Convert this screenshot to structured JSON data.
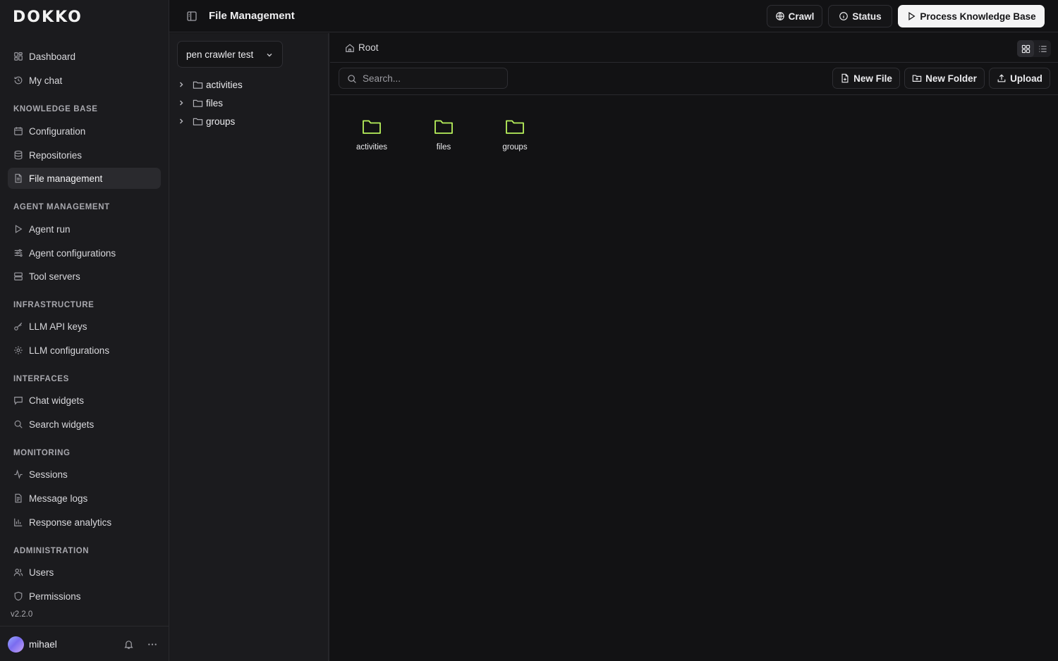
{
  "app": {
    "logo": "DOKKO",
    "version": "v2.2.0"
  },
  "sidebar": {
    "top_items": [
      {
        "label": "Dashboard",
        "icon": "dashboard-icon"
      },
      {
        "label": "My chat",
        "icon": "history-icon"
      }
    ],
    "sections": [
      {
        "title": "KNOWLEDGE BASE",
        "items": [
          {
            "label": "Configuration",
            "icon": "calendar-icon"
          },
          {
            "label": "Repositories",
            "icon": "database-icon"
          },
          {
            "label": "File management",
            "icon": "file-icon",
            "active": true
          }
        ]
      },
      {
        "title": "AGENT MANAGEMENT",
        "items": [
          {
            "label": "Agent run",
            "icon": "play-icon"
          },
          {
            "label": "Agent configurations",
            "icon": "sliders-icon"
          },
          {
            "label": "Tool servers",
            "icon": "server-icon"
          }
        ]
      },
      {
        "title": "INFRASTRUCTURE",
        "items": [
          {
            "label": "LLM API keys",
            "icon": "key-icon"
          },
          {
            "label": "LLM configurations",
            "icon": "gear-icon"
          }
        ]
      },
      {
        "title": "INTERFACES",
        "items": [
          {
            "label": "Chat widgets",
            "icon": "chat-icon"
          },
          {
            "label": "Search widgets",
            "icon": "search-icon"
          }
        ]
      },
      {
        "title": "MONITORING",
        "items": [
          {
            "label": "Sessions",
            "icon": "activity-icon"
          },
          {
            "label": "Message logs",
            "icon": "log-icon"
          },
          {
            "label": "Response analytics",
            "icon": "bar-chart-icon"
          }
        ]
      },
      {
        "title": "ADMINISTRATION",
        "items": [
          {
            "label": "Users",
            "icon": "users-icon"
          },
          {
            "label": "Permissions",
            "icon": "shield-icon"
          }
        ]
      }
    ],
    "user": {
      "name": "mihael"
    }
  },
  "header": {
    "title": "File Management",
    "crawl_label": "Crawl",
    "status_label": "Status",
    "process_label": "Process Knowledge Base"
  },
  "tree": {
    "repository": "pen crawler test",
    "folders": [
      "activities",
      "files",
      "groups"
    ]
  },
  "content": {
    "breadcrumb": "Root",
    "search_placeholder": "Search...",
    "new_file_label": "New File",
    "new_folder_label": "New Folder",
    "upload_label": "Upload",
    "view_mode": "grid",
    "folders": [
      "activities",
      "files",
      "groups"
    ]
  },
  "colors": {
    "accent_folder": "#b9f25c",
    "background": "#121214",
    "sidebar": "#1b1b1e"
  }
}
